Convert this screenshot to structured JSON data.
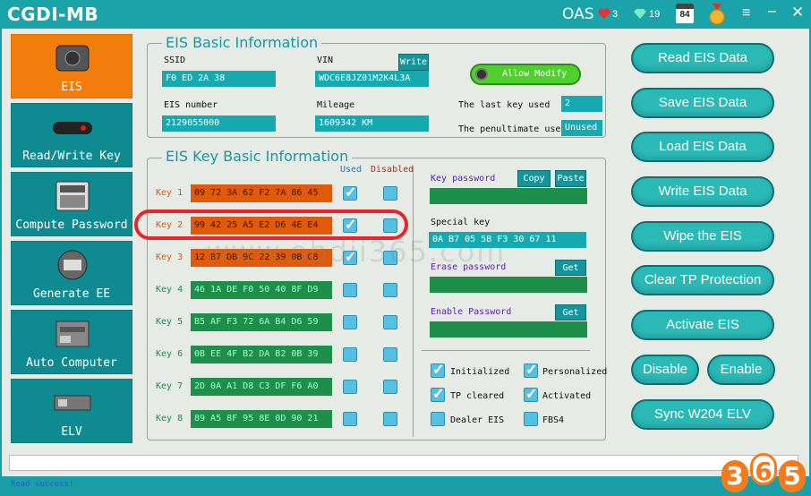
{
  "window": {
    "title": "CGDI-MB",
    "account": "OAS",
    "hearts": "3",
    "gems": "19",
    "calendar_day": "84"
  },
  "sidebar": {
    "items": [
      {
        "label": "EIS",
        "active": true
      },
      {
        "label": "Read/Write Key"
      },
      {
        "label": "Compute Password"
      },
      {
        "label": "Generate EE"
      },
      {
        "label": "Auto Computer"
      },
      {
        "label": "ELV"
      }
    ]
  },
  "eis_basic": {
    "title": "EIS Basic Information",
    "ssid_label": "SSID",
    "ssid_value": "F0 ED 2A 38",
    "vin_label": "VIN",
    "vin_write": "Write",
    "vin_value": "WDC6E8JZ01M2K4L3A",
    "allow_modify": "Allow Modify",
    "eis_number_label": "EIS number",
    "eis_number_value": "2129055000",
    "mileage_label": "Mileage",
    "mileage_value": "1609342 KM",
    "last_key_label": "The last key used",
    "last_key_value": "2",
    "penultimate_label": "The penultimate used",
    "penultimate_value": "Unused"
  },
  "eis_keys": {
    "title": "EIS Key Basic Information",
    "used_header": "Used",
    "disabled_header": "Disabled",
    "keys": [
      {
        "label": "Key 1",
        "value": "09 72 3A 62 F2 7A 86 45",
        "color": "#e05a0c",
        "used": true,
        "disabled": false
      },
      {
        "label": "Key 2",
        "value": "99 42 25 A5 E2 D6 4E E4",
        "color": "#e05a0c",
        "used": true,
        "disabled": false
      },
      {
        "label": "Key 3",
        "value": "12 B7 DB 9C 22 39 0B C8",
        "color": "#e05a0c",
        "used": true,
        "disabled": false
      },
      {
        "label": "Key 4",
        "value": "46 1A DE F0 50 40 8F D9",
        "color": "#1d8f4a",
        "used": false,
        "disabled": false
      },
      {
        "label": "Key 5",
        "value": "B5 AF F3 72 6A B4 D6 59",
        "color": "#1d8f4a",
        "used": false,
        "disabled": false
      },
      {
        "label": "Key 6",
        "value": "0B EE 4F B2 DA B2 0B 39",
        "color": "#1d8f4a",
        "used": false,
        "disabled": false
      },
      {
        "label": "Key 7",
        "value": "2D 0A A1 D8 C3 DF F6 A0",
        "color": "#1d8f4a",
        "used": false,
        "disabled": false
      },
      {
        "label": "Key 8",
        "value": "89 A5 8F 95 8E 0D 90 21",
        "color": "#1d8f4a",
        "used": false,
        "disabled": false
      }
    ],
    "key_password_label": "Key password",
    "copy": "Copy",
    "paste": "Paste",
    "special_key_label": "Special key",
    "special_key_value": "0A B7 05 5B F3 30 67 11",
    "erase_password_label": "Erase password",
    "get": "Get",
    "enable_password_label": "Enable Password",
    "options": {
      "initialized": "Initialized",
      "personalized": "Personalized",
      "tp_cleared": "TP cleared",
      "activated": "Activated",
      "dealer_eis": "Dealer EIS",
      "fbs4": "FBS4"
    }
  },
  "actions": {
    "read": "Read  EIS Data",
    "save": "Save EIS Data",
    "load": "Load EIS Data",
    "write": "Write EIS Data",
    "wipe": "Wipe the EIS",
    "clear_tp": "Clear TP Protection",
    "activate": "Activate EIS",
    "disable": "Disable",
    "enable": "Enable",
    "sync": "Sync W204 ELV"
  },
  "status": "Read success!",
  "watermark": "www.obdii365.com",
  "logo": [
    "3",
    "6",
    "5"
  ]
}
